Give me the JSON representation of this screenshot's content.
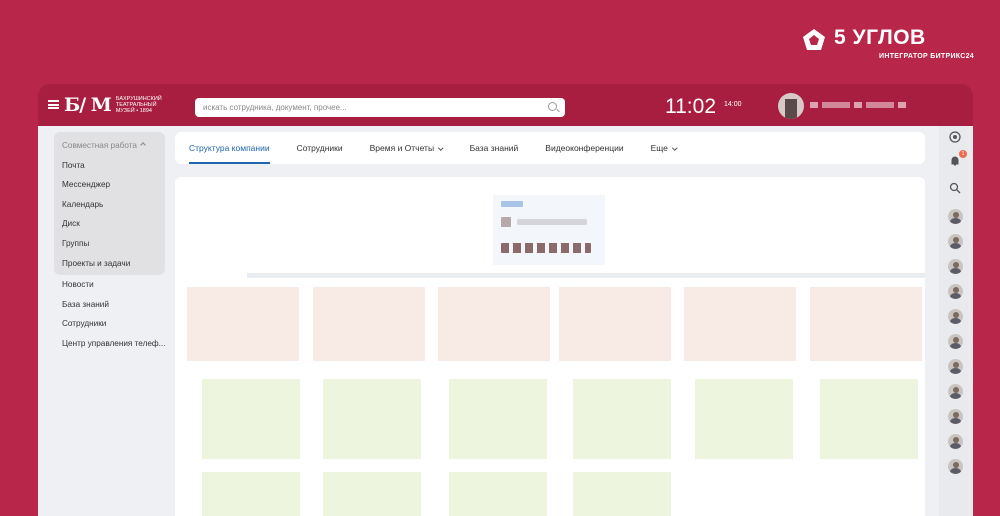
{
  "brand": {
    "name": "5 УГЛОВ",
    "subtitle": "ИНТЕГРАТОР БИТРИКС24",
    "color": "#ffffff"
  },
  "header": {
    "logo_mono": "Б/ М",
    "logo_text": "БАХРУШИНСКИЙ ТЕАТРАЛЬНЫЙ МУЗЕЙ • 1894",
    "search_placeholder": "искать сотрудника, документ, прочее...",
    "clock": "11:02",
    "clock_sub": "14:00"
  },
  "sidebar": {
    "group_title": "Совместная работа",
    "group_items": [
      "Почта",
      "Мессенджер",
      "Календарь",
      "Диск",
      "Группы",
      "Проекты и задачи"
    ],
    "items": [
      "Новости",
      "База знаний",
      "Сотрудники",
      "Центр управления телеф..."
    ]
  },
  "tabs": [
    {
      "label": "Структура компании",
      "active": true,
      "dropdown": false
    },
    {
      "label": "Сотрудники",
      "active": false,
      "dropdown": false
    },
    {
      "label": "Время и Отчеты",
      "active": false,
      "dropdown": true
    },
    {
      "label": "База знаний",
      "active": false,
      "dropdown": false
    },
    {
      "label": "Видеоконференции",
      "active": false,
      "dropdown": false
    },
    {
      "label": "Еще",
      "active": false,
      "dropdown": true
    }
  ],
  "rail": {
    "notification_count": "1",
    "icons": [
      "timeman-icon",
      "bell-icon",
      "search-icon"
    ]
  },
  "colors": {
    "background": "#b8264a",
    "accent": "#2067b0",
    "dept_card": "#f8ebe5",
    "team_card": "#eef5df"
  }
}
